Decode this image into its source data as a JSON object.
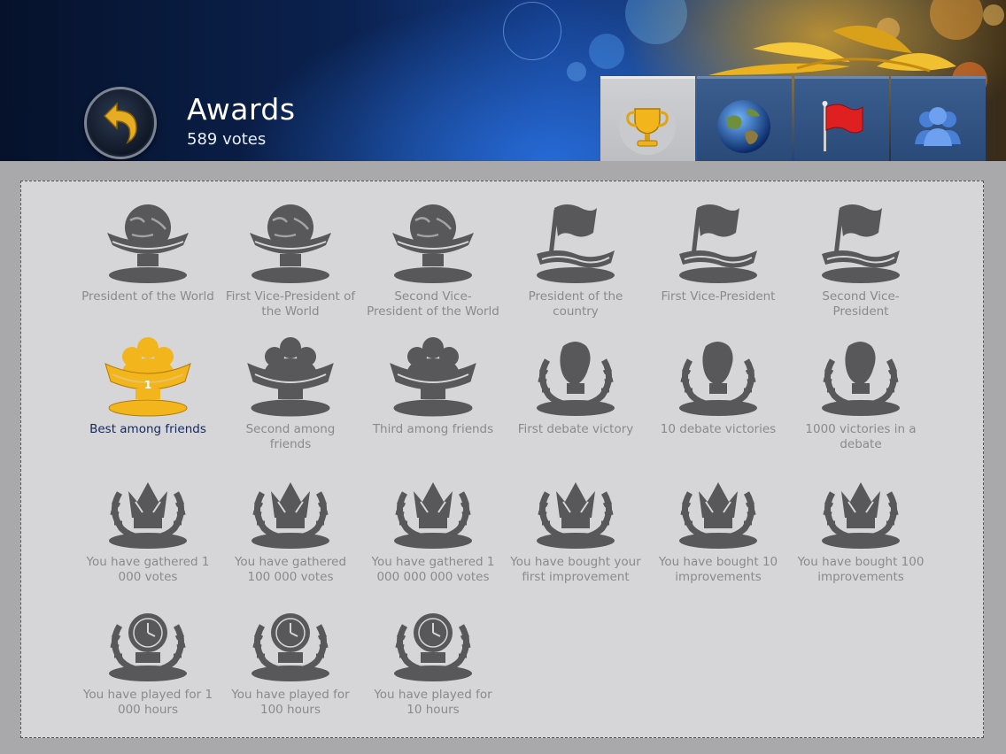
{
  "header": {
    "title": "Awards",
    "votes": "589 votes"
  },
  "tabs": [
    {
      "icon": "trophy-icon",
      "active": true
    },
    {
      "icon": "globe-icon",
      "active": false
    },
    {
      "icon": "flag-icon",
      "active": false
    },
    {
      "icon": "people-icon",
      "active": false
    }
  ],
  "colors": {
    "earned_label": "#14285a",
    "locked_label": "#8a8a8d",
    "locked_icon": "#58585b",
    "gold": "#f2b51c"
  },
  "awards": [
    {
      "label": "President of the World",
      "icon": "globe-trophy-icon",
      "earned": false
    },
    {
      "label": "First Vice-President of the World",
      "icon": "globe-trophy-icon",
      "earned": false
    },
    {
      "label": "Second Vice-President of the World",
      "icon": "globe-trophy-icon",
      "earned": false
    },
    {
      "label": "President of the country",
      "icon": "flag-trophy-icon",
      "earned": false
    },
    {
      "label": "First Vice-President",
      "icon": "flag-trophy-icon",
      "earned": false
    },
    {
      "label": "Second Vice-President",
      "icon": "flag-trophy-icon",
      "earned": false
    },
    {
      "label": "Best among friends",
      "icon": "friends-trophy-icon",
      "earned": true
    },
    {
      "label": "Second among friends",
      "icon": "friends-trophy-icon",
      "earned": false
    },
    {
      "label": "Third among friends",
      "icon": "friends-trophy-icon",
      "earned": false
    },
    {
      "label": "First debate victory",
      "icon": "boxing-glove-trophy-icon",
      "earned": false
    },
    {
      "label": "10 debate victories",
      "icon": "boxing-glove-trophy-icon",
      "earned": false
    },
    {
      "label": "1000 victories in a debate",
      "icon": "boxing-glove-trophy-icon",
      "earned": false
    },
    {
      "label": "You have gathered 1 000 votes",
      "icon": "crown-wreath-icon",
      "earned": false
    },
    {
      "label": "You have gathered 100 000 votes",
      "icon": "crown-wreath-icon",
      "earned": false
    },
    {
      "label": "You have gathered 1 000 000 000 votes",
      "icon": "crown-wreath-icon",
      "earned": false
    },
    {
      "label": "You have bought your first improvement",
      "icon": "crown-wreath-icon",
      "earned": false
    },
    {
      "label": "You have bought 10 improvements",
      "icon": "crown-wreath-icon",
      "earned": false
    },
    {
      "label": "You have bought 100 improvements",
      "icon": "crown-wreath-icon",
      "earned": false
    },
    {
      "label": "You have played for 1 000 hours",
      "icon": "clock-wreath-icon",
      "earned": false
    },
    {
      "label": "You have played for 100 hours",
      "icon": "clock-wreath-icon",
      "earned": false
    },
    {
      "label": "You have played for 10 hours",
      "icon": "clock-wreath-icon",
      "earned": false
    }
  ],
  "earned_badge_number": "1"
}
